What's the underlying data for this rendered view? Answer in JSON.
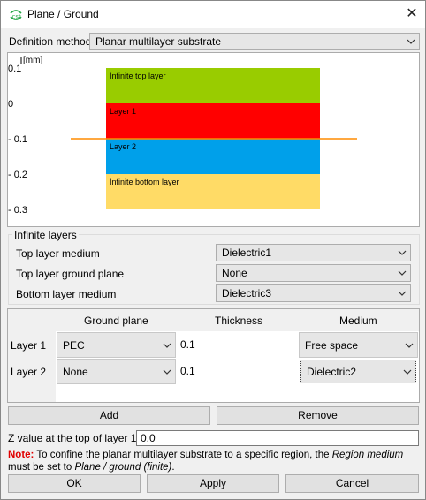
{
  "window": {
    "title": "Plane / Ground",
    "close_glyph": "✕",
    "logo_icon": "cst-logo-icon"
  },
  "definition": {
    "label": "Definition method",
    "value": "Planar multilayer substrate"
  },
  "chart_data": {
    "type": "diagram",
    "unit_label": "[mm]",
    "y_ticks": [
      "0.1",
      "0",
      "- 0.1",
      "- 0.2",
      "- 0.3"
    ],
    "y_tick_values": [
      0.1,
      0,
      -0.1,
      -0.2,
      -0.3
    ],
    "ylim": [
      0.1,
      -0.3
    ],
    "layers": [
      {
        "name": "Infinite top layer",
        "top": 0.1,
        "bottom": 0.0,
        "color": "#99cc00"
      },
      {
        "name": "Layer 1",
        "top": 0.0,
        "bottom": -0.1,
        "color": "#ff0000"
      },
      {
        "name": "Layer 2",
        "top": -0.1,
        "bottom": -0.2,
        "color": "#00a0ea"
      },
      {
        "name": "Infinite bottom layer",
        "top": -0.2,
        "bottom": -0.3,
        "color": "#ffdb66"
      }
    ],
    "ground_plane": {
      "y": -0.1,
      "color": "#ff8c00"
    }
  },
  "infinite_layers": {
    "title": "Infinite layers",
    "top_medium": {
      "label": "Top layer medium",
      "value": "Dielectric1"
    },
    "top_ground": {
      "label": "Top layer ground plane",
      "value": "None"
    },
    "bottom_medium": {
      "label": "Bottom layer medium",
      "value": "Dielectric3"
    }
  },
  "layer_table": {
    "headers": [
      "Ground plane",
      "Thickness",
      "Medium"
    ],
    "rows": [
      {
        "label": "Layer 1",
        "ground": "PEC",
        "thickness": "0.1",
        "medium": "Free space"
      },
      {
        "label": "Layer 2",
        "ground": "None",
        "thickness": "0.1",
        "medium": "Dielectric2"
      }
    ]
  },
  "buttons": {
    "add": "Add",
    "remove": "Remove",
    "ok": "OK",
    "apply": "Apply",
    "cancel": "Cancel"
  },
  "z_value": {
    "label": "Z value at the top of layer 1",
    "value": "0.0"
  },
  "note": {
    "prefix": "Note:",
    "text1": " To confine the planar multilayer substrate to a specific region, the ",
    "em1": "Region medium",
    "text2": " must be set to ",
    "em2": "Plane / ground (finite)",
    "text3": "."
  }
}
